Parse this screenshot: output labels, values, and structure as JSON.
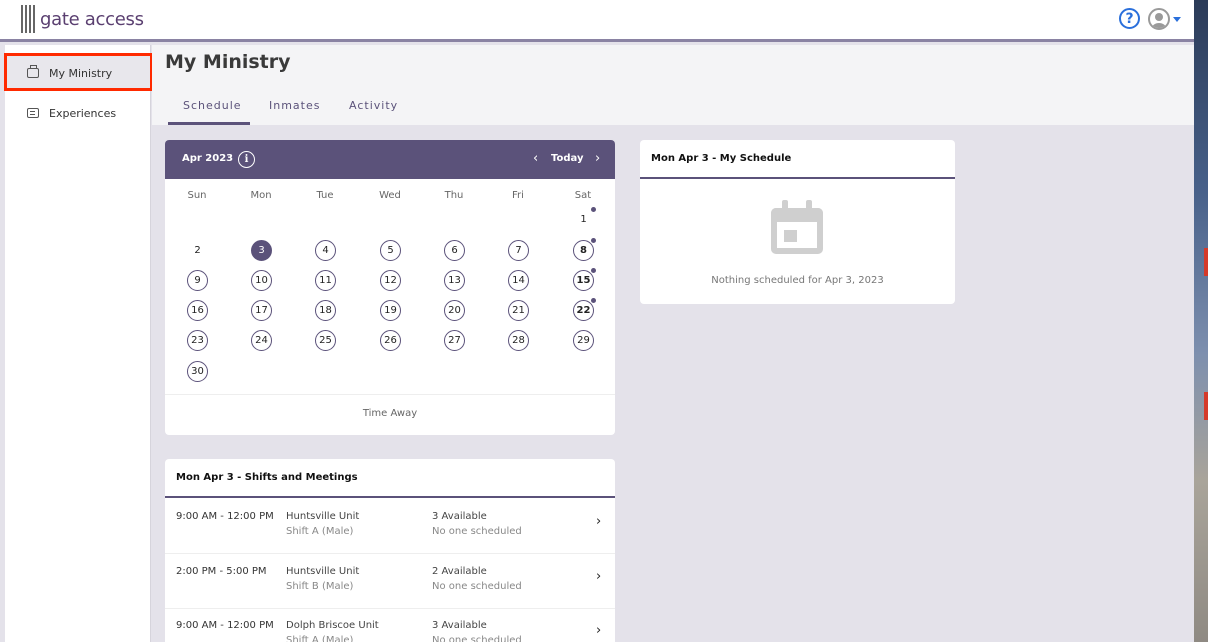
{
  "app": {
    "logo_text": "gate access"
  },
  "sidebar": {
    "items": [
      {
        "label": "My Ministry"
      },
      {
        "label": "Experiences"
      }
    ]
  },
  "page": {
    "title": "My Ministry"
  },
  "tabs": [
    {
      "label": "Schedule"
    },
    {
      "label": "Inmates"
    },
    {
      "label": "Activity"
    }
  ],
  "calendar": {
    "month_label": "Apr 2023",
    "info_glyph": "i",
    "prev_glyph": "‹",
    "today_label": "Today",
    "next_glyph": "›",
    "weekdays": [
      "Sun",
      "Mon",
      "Tue",
      "Wed",
      "Thu",
      "Fri",
      "Sat"
    ],
    "days": [
      "1",
      "2",
      "3",
      "4",
      "5",
      "6",
      "7",
      "8",
      "9",
      "10",
      "11",
      "12",
      "13",
      "14",
      "15",
      "16",
      "17",
      "18",
      "19",
      "20",
      "21",
      "22",
      "23",
      "24",
      "25",
      "26",
      "27",
      "28",
      "29",
      "30"
    ],
    "selected_day": "3",
    "days_with_events": [
      "1",
      "8",
      "15",
      "22"
    ],
    "time_away_label": "Time Away"
  },
  "my_schedule": {
    "title": "Mon Apr 3 - My Schedule",
    "empty_text": "Nothing scheduled for Apr 3, 2023"
  },
  "shifts": {
    "title": "Mon Apr 3 - Shifts and Meetings",
    "chevron_glyph": "›",
    "rows": [
      {
        "time": "9:00 AM - 12:00 PM",
        "place": "Huntsville Unit",
        "shift": "Shift A (Male)",
        "available": "3 Available",
        "status": "No one scheduled"
      },
      {
        "time": "2:00 PM - 5:00 PM",
        "place": "Huntsville Unit",
        "shift": "Shift B (Male)",
        "available": "2 Available",
        "status": "No one scheduled"
      },
      {
        "time": "9:00 AM - 12:00 PM",
        "place": "Dolph Briscoe Unit",
        "shift": "Shift A (Male)",
        "available": "3 Available",
        "status": "No one scheduled"
      }
    ]
  },
  "colors": {
    "accent": "#5b527a",
    "highlight": "#ff2a00",
    "help": "#2a6fdb"
  }
}
